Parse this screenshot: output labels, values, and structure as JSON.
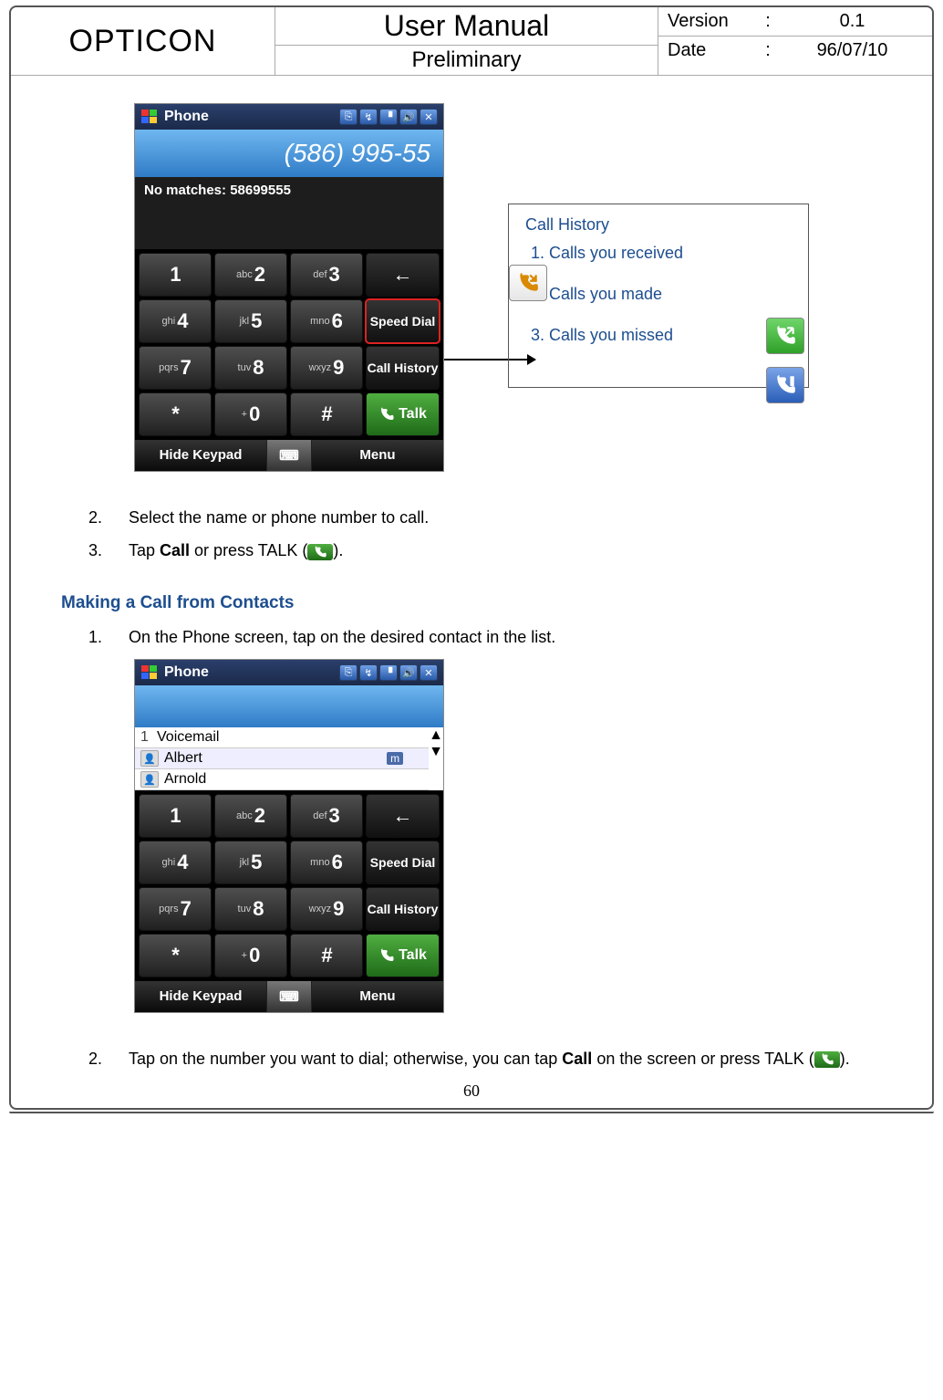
{
  "header": {
    "brand": "OPTICON",
    "title": "User Manual",
    "subtitle": "Preliminary",
    "version_label": "Version",
    "version_value": "0.1",
    "date_label": "Date",
    "date_value": "96/07/10",
    "colon": ":"
  },
  "phone1": {
    "titlebar": "Phone",
    "dialed_number": "(586) 995-55",
    "nomatch": "No matches: 58699555",
    "keys": {
      "k1": "1",
      "k2s": "abc",
      "k2": "2",
      "k3s": "def",
      "k3": "3",
      "k4s": "ghi",
      "k4": "4",
      "k5s": "jkl",
      "k5": "5",
      "k6s": "mno",
      "k6": "6",
      "k7s": "pqrs",
      "k7": "7",
      "k8s": "tuv",
      "k8": "8",
      "k9s": "wxyz",
      "k9": "9",
      "kstar": "*",
      "k0s": "+",
      "k0": "0",
      "khash": "#",
      "back": "←",
      "speed": "Speed Dial",
      "history": "Call History",
      "talk": "Talk"
    },
    "soft_left": "Hide Keypad",
    "soft_right": "Menu"
  },
  "callout": {
    "title": "Call History",
    "i1": "Calls you received",
    "i2": "Calls you made",
    "i3": "Calls you missed"
  },
  "steps_a": {
    "s2n": "2.",
    "s2": "Select the name or phone number to call.",
    "s3n": "3.",
    "s3a": "Tap ",
    "s3b": "Call",
    "s3c": " or press TALK (",
    "s3d": ")."
  },
  "section2": "Making a Call from Contacts",
  "steps_b": {
    "s1n": "1.",
    "s1": "On the Phone screen, tap on the desired contact in the list."
  },
  "phone2": {
    "titlebar": "Phone",
    "contacts": {
      "c1n": "1",
      "c1": "Voicemail",
      "c2": "Albert",
      "c2b": "m",
      "c3": "Arnold"
    }
  },
  "steps_c": {
    "s2n": "2.",
    "s2a": "Tap on the number you want to dial; otherwise, you can tap ",
    "s2b": "Call",
    "s2c": " on the screen or press TALK (",
    "s2d": ")."
  },
  "page_number": "60"
}
